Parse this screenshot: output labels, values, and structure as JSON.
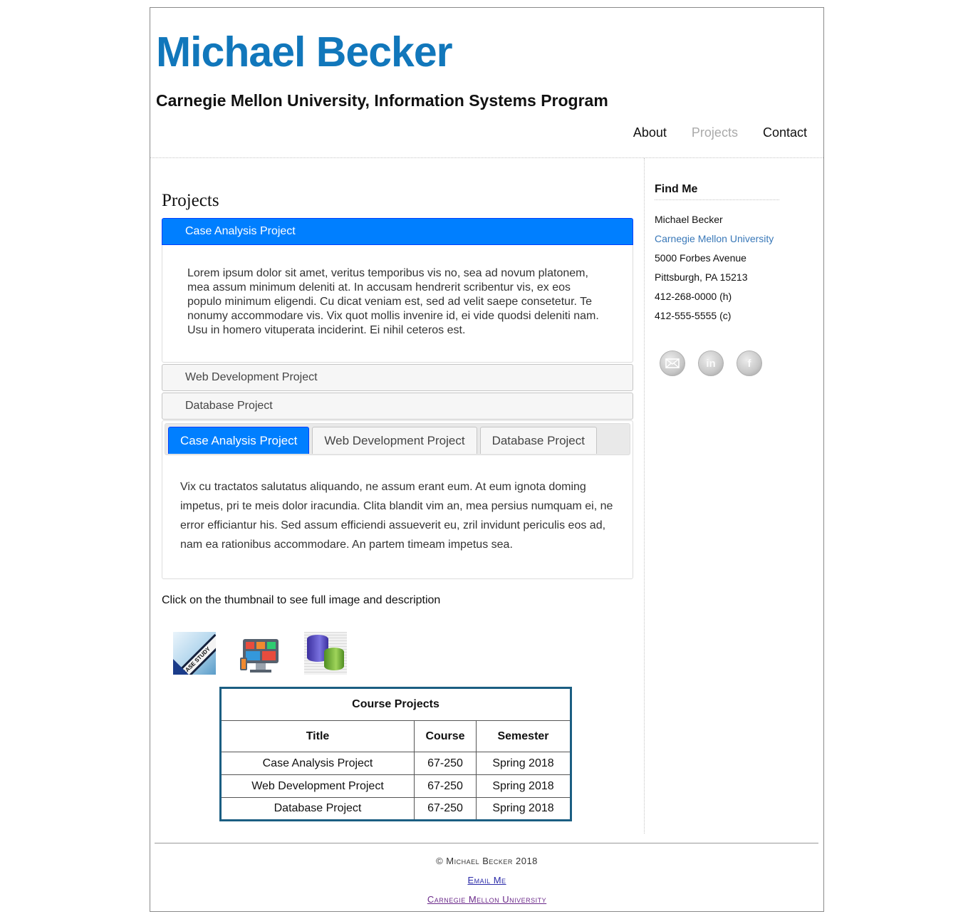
{
  "header": {
    "name": "Michael Becker",
    "tagline": "Carnegie Mellon University, Information Systems Program"
  },
  "nav": {
    "items": [
      {
        "label": "About"
      },
      {
        "label": "Projects",
        "current": true
      },
      {
        "label": "Contact"
      }
    ]
  },
  "main": {
    "title": "Projects",
    "accordion": {
      "sections": [
        {
          "label": "Case Analysis Project",
          "expanded": true
        },
        {
          "label": "Web Development Project"
        },
        {
          "label": "Database Project"
        }
      ],
      "open_content": "Lorem ipsum dolor sit amet, veritus temporibus vis no, sea ad novum platonem, mea assum minimum deleniti at. In accusam hendrerit scribentur vis, ex eos populo minimum eligendi. Cu dicat veniam est, sed ad velit saepe consetetur. Te nonumy accommodare vis. Vix quot mollis invenire id, ei vide quodsi deleniti nam. Usu in homero vituperata inciderint. Ei nihil ceteros est."
    },
    "tabs": {
      "items": [
        {
          "label": "Case Analysis Project",
          "active": true
        },
        {
          "label": "Web Development Project"
        },
        {
          "label": "Database Project"
        }
      ],
      "active_content": "Vix cu tractatos salutatus aliquando, ne assum erant eum. At eum ignota doming impetus, pri te meis dolor iracundia. Clita blandit vim an, mea persius numquam ei, ne error efficiantur his. Sed assum efficiendi assueverit eu, zril invidunt periculis eos ad, nam ea rationibus accommodare. An partem timeam impetus sea."
    },
    "thumbnail_caption": "Click on the thumbnail to see full image and description",
    "thumbnails": [
      {
        "icon": "case-study-thumbnail",
        "text": "CASE STUDY"
      },
      {
        "icon": "web-development-thumbnail"
      },
      {
        "icon": "database-thumbnail"
      }
    ],
    "table": {
      "caption": "Course Projects",
      "columns": [
        "Title",
        "Course",
        "Semester"
      ],
      "rows": [
        [
          "Case Analysis Project",
          "67-250",
          "Spring 2018"
        ],
        [
          "Web Development Project",
          "67-250",
          "Spring 2018"
        ],
        [
          "Database Project",
          "67-250",
          "Spring 2018"
        ]
      ]
    }
  },
  "sidebar": {
    "title": "Find Me",
    "lines": [
      "Michael Becker",
      "Carnegie Mellon University",
      "5000 Forbes Avenue",
      "Pittsburgh, PA 15213",
      "412-268-0000 (h)",
      "412-555-5555 (c)"
    ],
    "social_icons": [
      "email-icon",
      "linkedin-icon",
      "facebook-icon"
    ]
  },
  "footer": {
    "copyright": "© Michael Becker 2018",
    "email_link": "Email Me",
    "university_link": "Carnegie Mellon University"
  },
  "colors": {
    "brand_blue": "#1177bb",
    "active_blue": "#007fff",
    "table_border": "#1b5e82",
    "nav_current": "#aaaaaa"
  }
}
